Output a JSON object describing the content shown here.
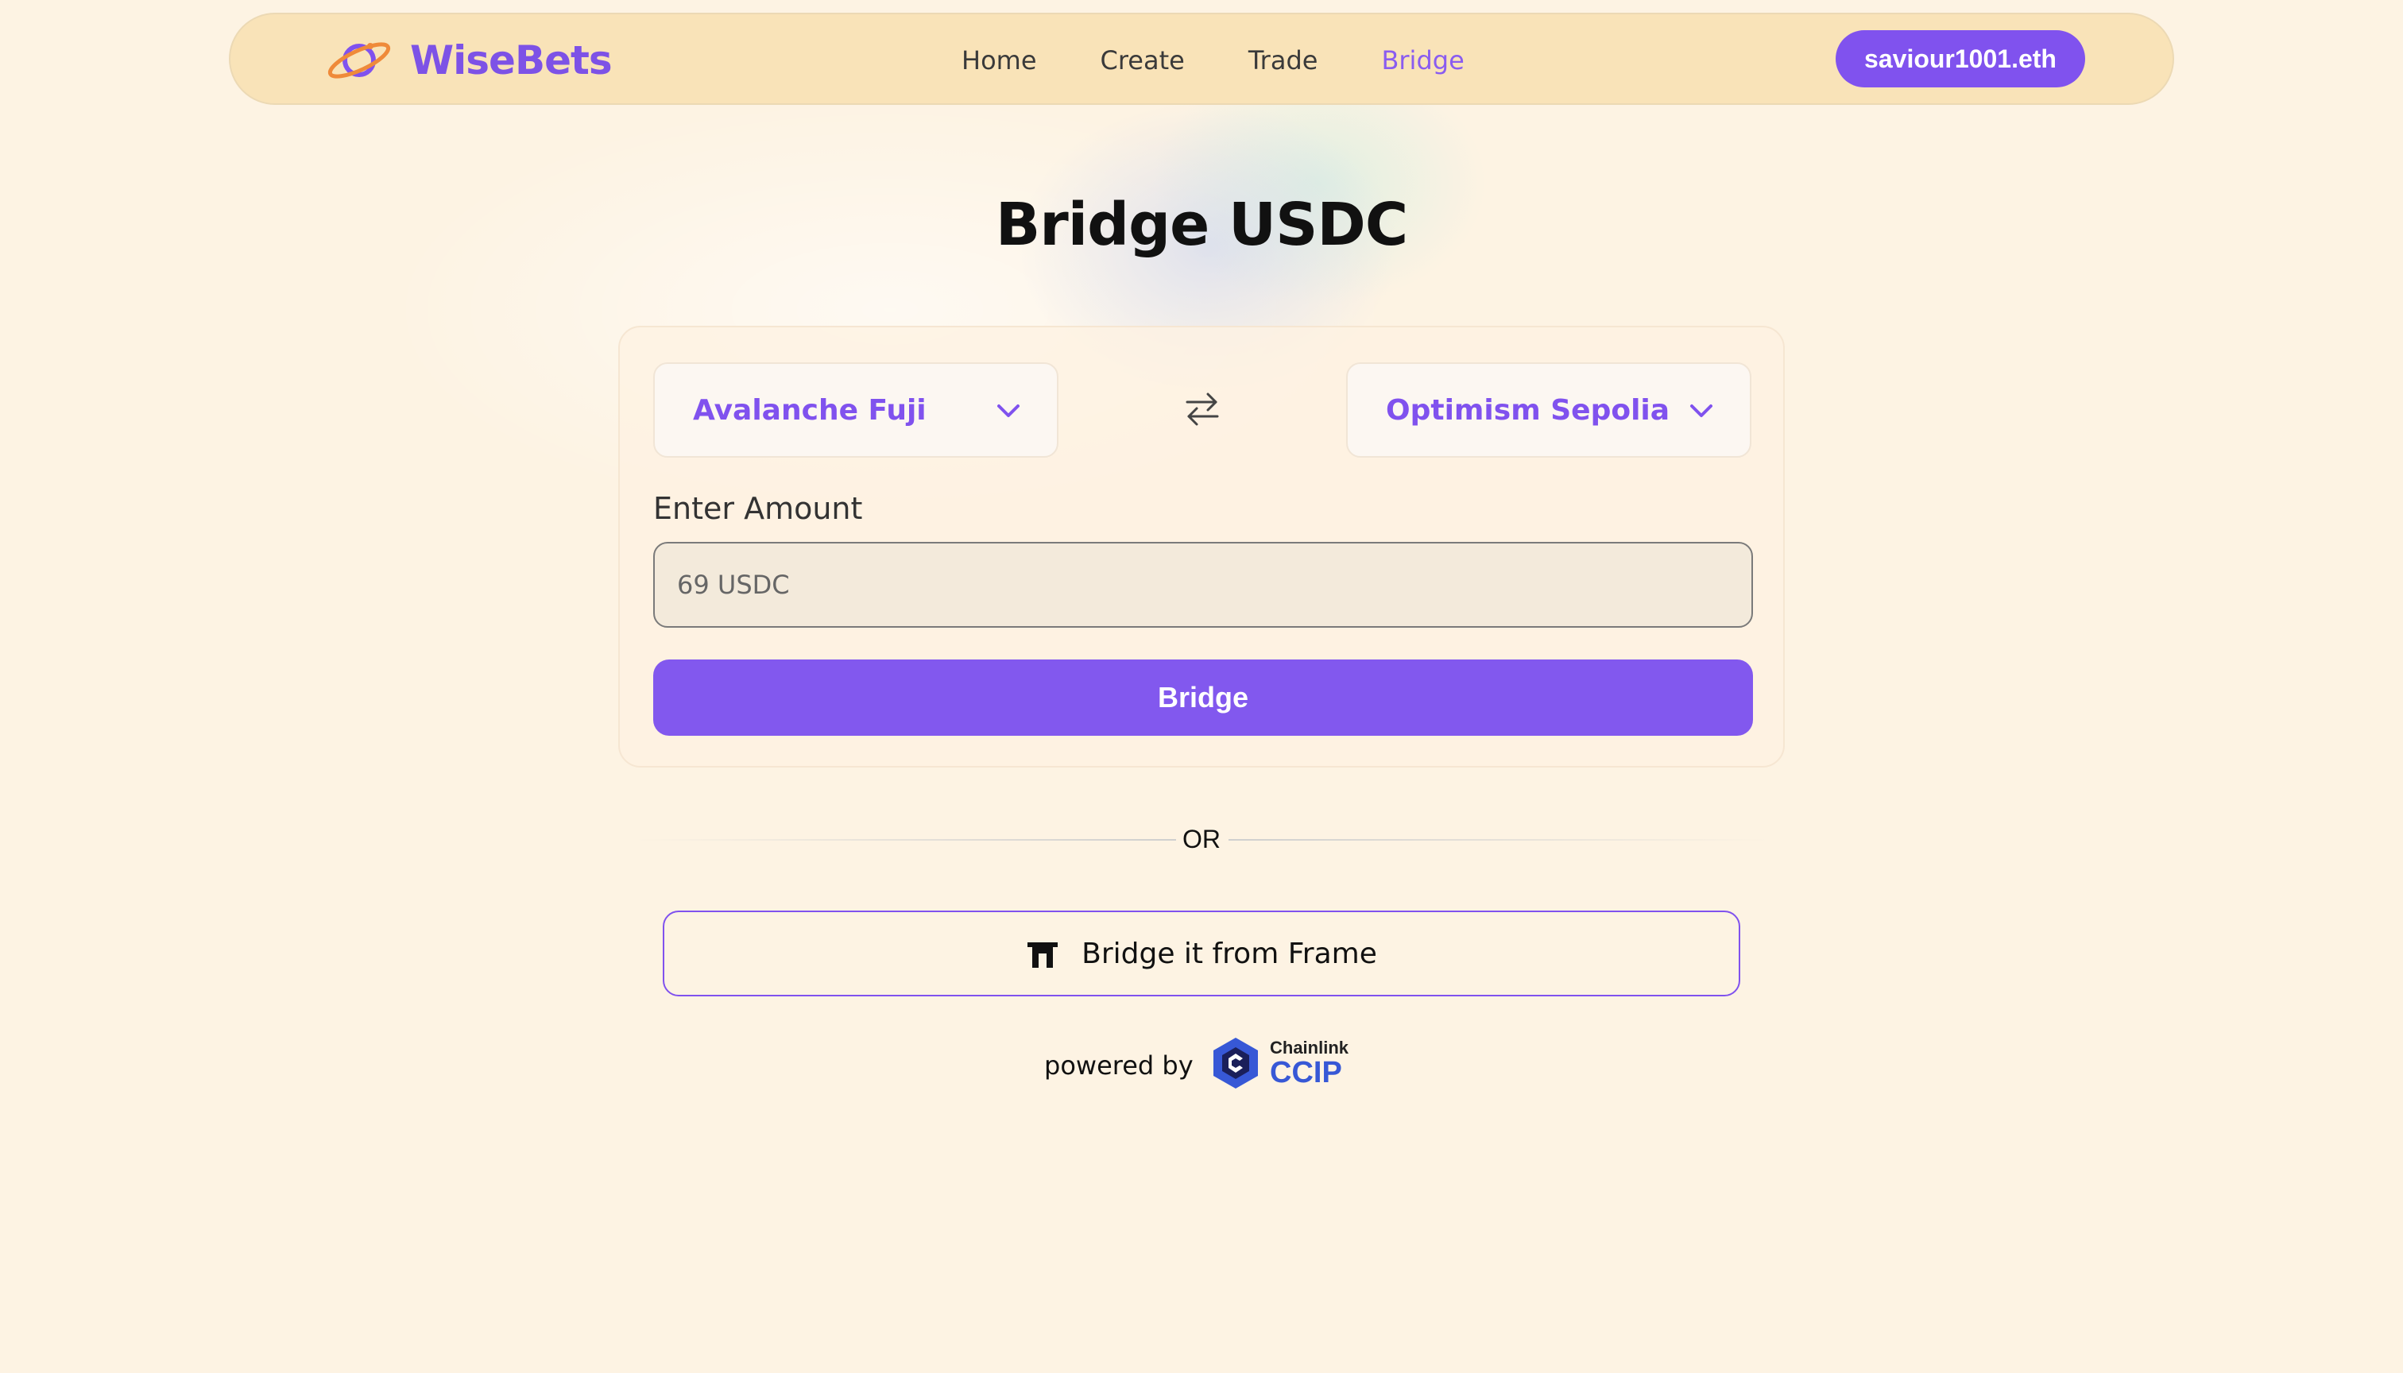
{
  "brand": {
    "name": "WiseBets",
    "icon": "planet-logo-icon"
  },
  "nav": {
    "items": [
      {
        "label": "Home",
        "active": false
      },
      {
        "label": "Create",
        "active": false
      },
      {
        "label": "Trade",
        "active": false
      },
      {
        "label": "Bridge",
        "active": true
      }
    ]
  },
  "wallet": {
    "label": "saviour1001.eth"
  },
  "page": {
    "title": "Bridge USDC"
  },
  "bridge_form": {
    "source_chain": "Avalanche Fuji",
    "destination_chain": "Optimism Sepolia",
    "amount_label": "Enter Amount",
    "amount_placeholder": "69 USDC",
    "submit_label": "Bridge"
  },
  "divider": {
    "label": "OR"
  },
  "frame": {
    "label": "Bridge it from Frame",
    "icon": "frame-arch-icon"
  },
  "footer": {
    "powered_by": "powered by",
    "provider_top": "Chainlink",
    "provider_bottom": "CCIP"
  },
  "colors": {
    "accent": "#8052ee",
    "background": "#fdf3e3",
    "navbar": "#f9e3b8",
    "ccip_blue": "#3758d6"
  }
}
